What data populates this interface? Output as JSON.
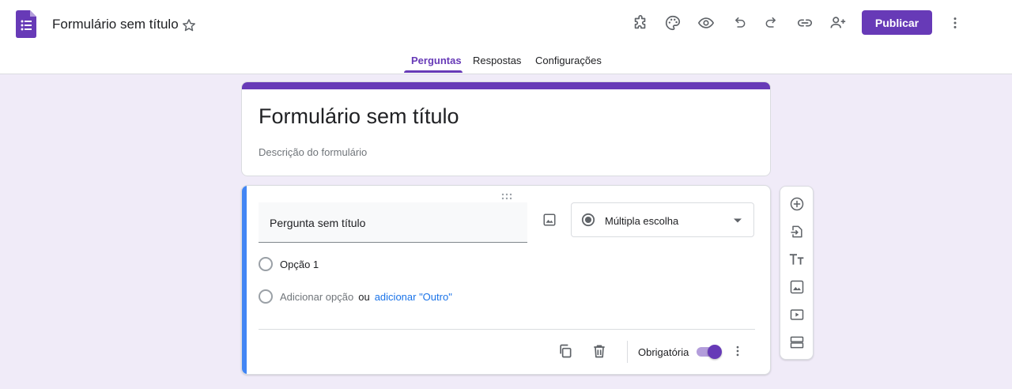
{
  "header": {
    "title": "Formulário sem título",
    "publish_label": "Publicar",
    "icons": [
      "puzzle-icon",
      "palette-icon",
      "preview-icon",
      "undo-icon",
      "redo-icon",
      "link-icon",
      "add-collaborator-icon",
      "more-vert-icon"
    ],
    "accent_color": "#673ab7"
  },
  "tabs": [
    {
      "label": "Perguntas",
      "active": true
    },
    {
      "label": "Respostas",
      "active": false
    },
    {
      "label": "Configurações",
      "active": false
    }
  ],
  "form": {
    "title": "Formulário sem título",
    "description_placeholder": "Descrição do formulário"
  },
  "question": {
    "title": "Pergunta sem título",
    "type": "Múltipla escolha",
    "options": [
      {
        "label": "Opção 1"
      }
    ],
    "add_option": "Adicionar opção",
    "or": "ou",
    "add_other": "adicionar \"Outro\"",
    "required_label": "Obrigatória",
    "required_on": true,
    "left_bar_color": "#4285f4"
  },
  "side_toolbar": {
    "icons": [
      "add-question-icon",
      "import-questions-icon",
      "add-title-icon",
      "add-image-icon",
      "add-video-icon",
      "add-section-icon"
    ]
  }
}
